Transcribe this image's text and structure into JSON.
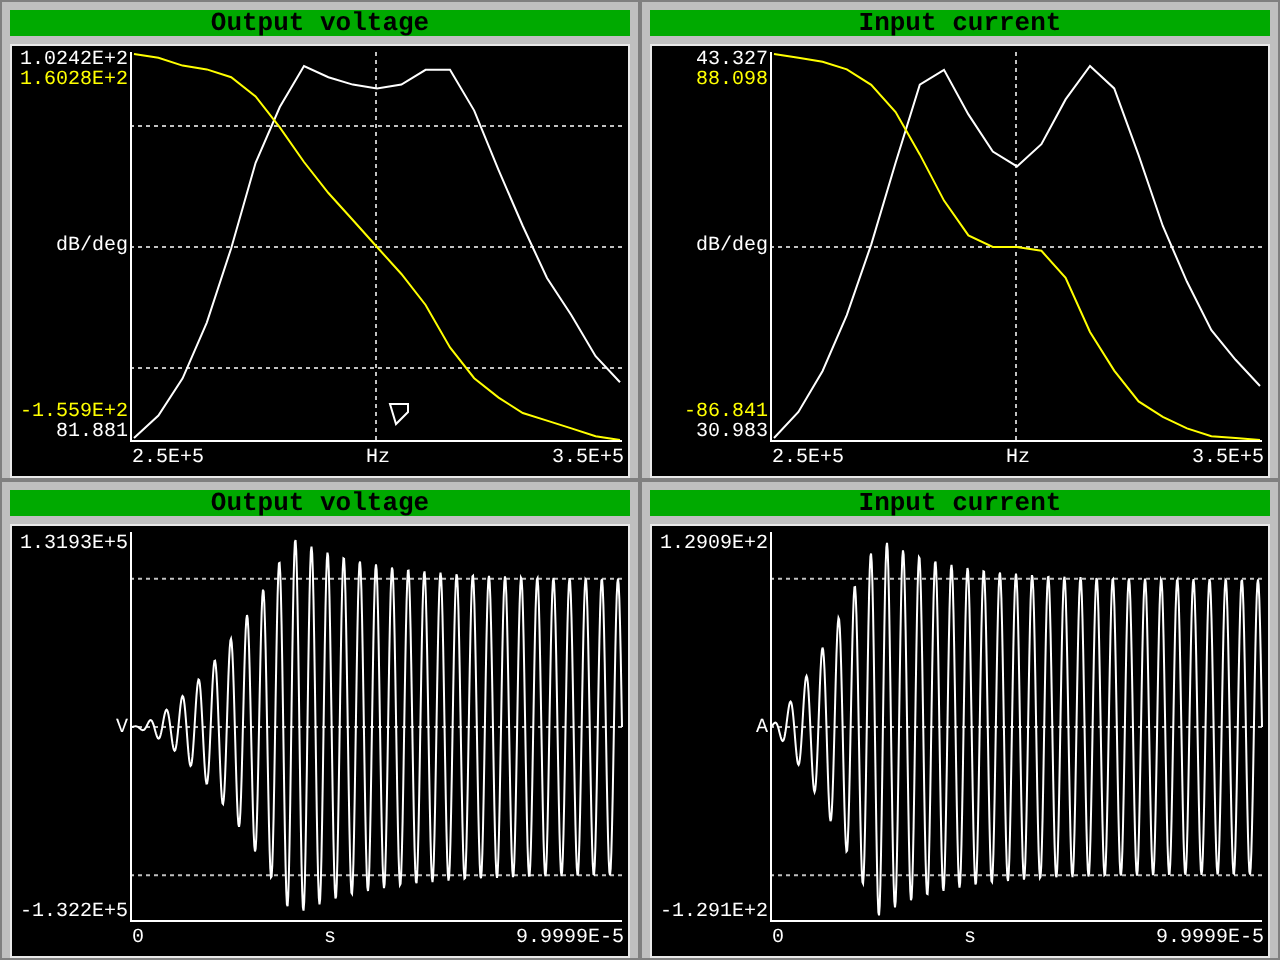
{
  "panels": [
    {
      "kind": "voltagebode",
      "title": "Output voltage",
      "pointer": true,
      "y_labels": {
        "top_magnitude": "1.0242E+2",
        "top_phase": "1.6028E+2",
        "unit": "dB/deg",
        "bottom_phase": "-1.559E+2",
        "bottom_magnitude": "81.881"
      },
      "x_labels": {
        "start": "2.5E+5",
        "unit": "Hz",
        "end": "3.5E+5"
      }
    },
    {
      "kind": "currentbode",
      "title": "Input current",
      "pointer": false,
      "y_labels": {
        "top_magnitude": "43.327",
        "top_phase": "88.098",
        "unit": "dB/deg",
        "bottom_phase": "-86.841",
        "bottom_magnitude": "30.983"
      },
      "x_labels": {
        "start": "2.5E+5",
        "unit": "Hz",
        "end": "3.5E+5"
      }
    },
    {
      "kind": "voltagewave",
      "title": "Output voltage",
      "y_labels": {
        "top": "1.3193E+5",
        "unit": "V",
        "bottom": "-1.322E+5"
      },
      "x_labels": {
        "start": "0",
        "unit": "s",
        "end": "9.9999E-5"
      }
    },
    {
      "kind": "currentwave",
      "title": "Input current",
      "y_labels": {
        "top": "1.2909E+2",
        "unit": "A",
        "bottom": "-1.291E+2"
      },
      "x_labels": {
        "start": "0",
        "unit": "s",
        "end": "9.9999E-5"
      }
    }
  ]
}
